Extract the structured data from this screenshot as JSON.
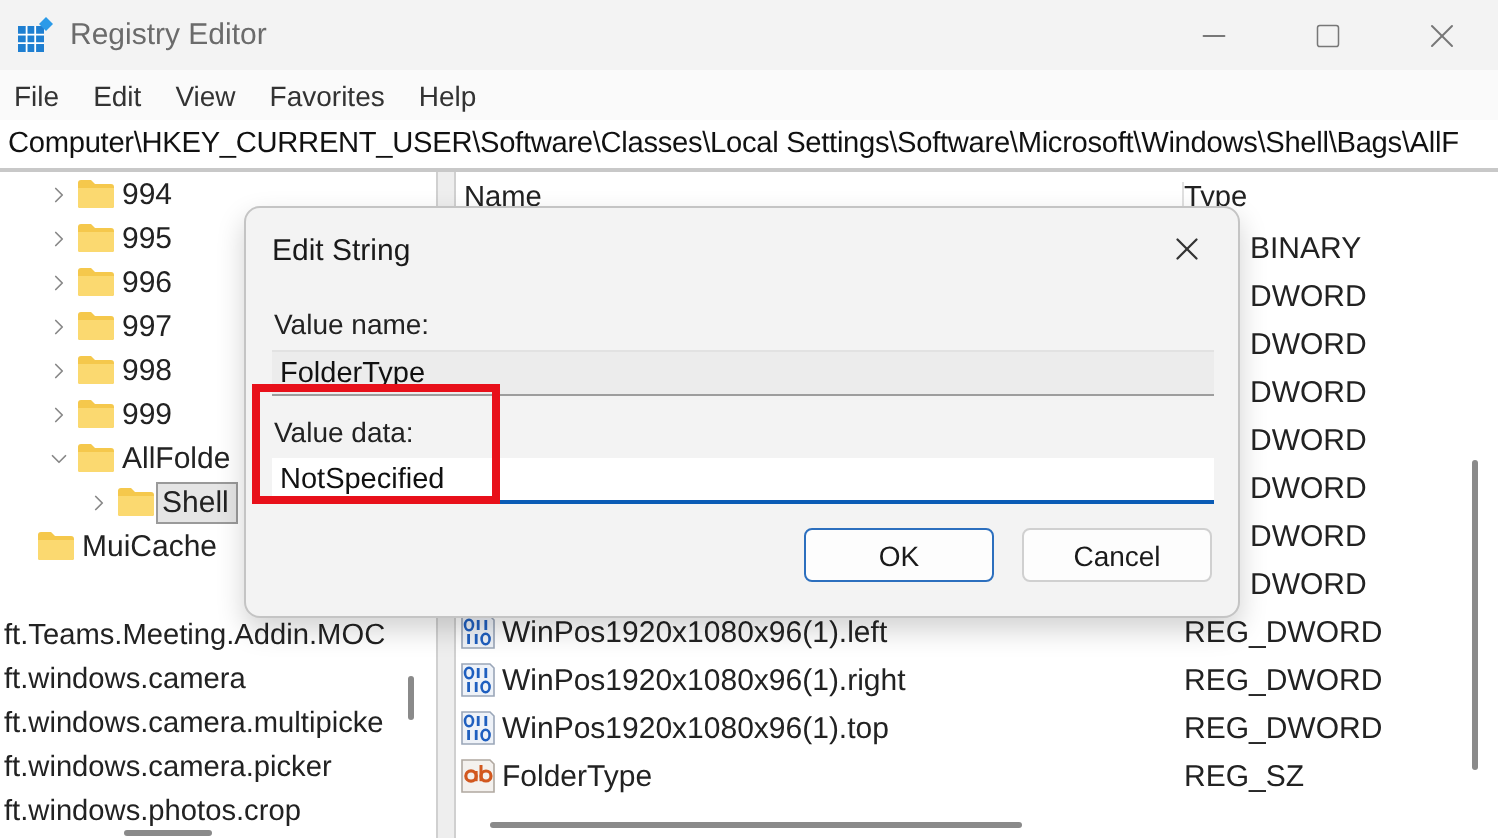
{
  "window": {
    "title": "Registry Editor"
  },
  "menu": [
    "File",
    "Edit",
    "View",
    "Favorites",
    "Help"
  ],
  "address": "Computer\\HKEY_CURRENT_USER\\Software\\Classes\\Local Settings\\Software\\Microsoft\\Windows\\Shell\\Bags\\AllF",
  "tree": {
    "nodes": [
      {
        "children": [
          {
            "label": "994",
            "expandable": true,
            "expanded": false,
            "selected": false
          },
          {
            "label": "995",
            "expandable": true,
            "expanded": false,
            "selected": false
          },
          {
            "label": "996",
            "expandable": true,
            "expanded": false,
            "selected": false
          },
          {
            "label": "997",
            "expandable": true,
            "expanded": false,
            "selected": false
          },
          {
            "label": "998",
            "expandable": true,
            "expanded": false,
            "selected": false
          },
          {
            "label": "999",
            "expandable": true,
            "expanded": false,
            "selected": false
          },
          {
            "label": "AllFolde",
            "expandable": true,
            "expanded": true,
            "selected": false,
            "children": [
              {
                "label": "Shell",
                "expandable": true,
                "expanded": false,
                "selected": true
              }
            ]
          }
        ]
      },
      {
        "label": "MuiCache",
        "expandable": false,
        "selected": false
      }
    ]
  },
  "keys": [
    "ft.Teams.Meeting.Addin.MOC",
    "ft.windows.camera",
    "ft.windows.camera.multipicke",
    "ft.windows.camera.picker",
    "ft.windows.photos.crop"
  ],
  "values": {
    "columns": [
      "Name",
      "Type"
    ],
    "rows": [
      {
        "kind": "covered",
        "type": "BINARY"
      },
      {
        "kind": "covered",
        "type": "DWORD"
      },
      {
        "kind": "covered",
        "type": "DWORD"
      },
      {
        "kind": "covered",
        "type": "DWORD"
      },
      {
        "kind": "covered",
        "type": "DWORD"
      },
      {
        "kind": "covered",
        "type": "DWORD"
      },
      {
        "kind": "covered",
        "type": "DWORD"
      },
      {
        "kind": "covered",
        "type": "DWORD"
      },
      {
        "kind": "binary",
        "name": "WinPos1920x1080x96(1).left",
        "type": "REG_DWORD"
      },
      {
        "kind": "binary",
        "name": "WinPos1920x1080x96(1).right",
        "type": "REG_DWORD"
      },
      {
        "kind": "binary",
        "name": "WinPos1920x1080x96(1).top",
        "type": "REG_DWORD"
      },
      {
        "kind": "string",
        "name": "FolderType",
        "type": "REG_SZ"
      }
    ]
  },
  "dialog": {
    "title": "Edit String",
    "fields": [
      {
        "label": "Value name:",
        "value": "FolderType",
        "disabled": true,
        "highlighted": false
      },
      {
        "label": "Value data:",
        "value": "NotSpecified",
        "disabled": false,
        "highlighted": true
      }
    ],
    "buttons": [
      {
        "label": "OK",
        "default": true
      },
      {
        "label": "Cancel",
        "default": false
      }
    ]
  }
}
